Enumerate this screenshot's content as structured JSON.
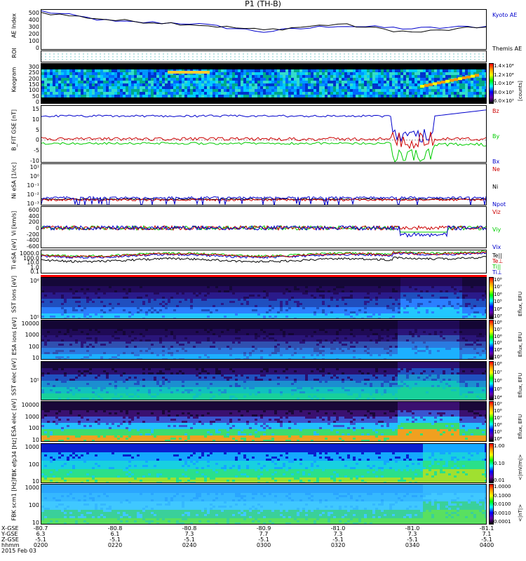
{
  "title": "P1 (TH-B)",
  "colors": {
    "black": "#000000",
    "blue": "#0000cc",
    "red": "#cc0000",
    "green": "#00cc00"
  },
  "panels": {
    "ae": {
      "ylabel": "AE Index",
      "yticks": [
        "500",
        "400",
        "300",
        "200",
        "100",
        "0"
      ],
      "legend": [
        "Kyoto AE",
        "Themis AE"
      ]
    },
    "roi": {
      "ylabel": "ROI"
    },
    "keo": {
      "ylabel": "Keogram",
      "yticks": [
        "300",
        "250",
        "200",
        "150",
        "100",
        "50",
        "0"
      ],
      "unit": "[counts]",
      "cticks": [
        "1.4×10⁴",
        "1.2×10⁴",
        "1.0×10⁴",
        "8.0×10³",
        "6.0×10³"
      ]
    },
    "bfit": {
      "ylabel": "B_FIT GSE [nT]",
      "yticks": [
        "15",
        "10",
        "5",
        "0",
        "-5",
        "-10"
      ],
      "legend": [
        "Bz",
        "By",
        "Bx"
      ]
    },
    "ni": {
      "ylabel": "Ni eSA [1/cc]",
      "yticks": [
        "10¹",
        "10⁰",
        "10⁻¹",
        "10⁻²",
        "10⁻³"
      ],
      "legend": [
        "Ne",
        "Ni",
        "Npot"
      ]
    },
    "vi": {
      "ylabel": "Vi [km/s]",
      "yticks": [
        "600",
        "400",
        "200",
        "0",
        "-200",
        "-400",
        "-600"
      ],
      "legend": [
        "Viz",
        "Viy",
        "Vix"
      ]
    },
    "ti": {
      "ylabel": "Ti eSA [eV]",
      "yticks": [
        "1000.0",
        "100.0",
        "10.0",
        "1.0",
        "0.1"
      ],
      "legend": [
        "Te||",
        "Te⊥",
        "Ti||",
        "Ti⊥"
      ]
    },
    "sst_i": {
      "ylabel": "SST ions [eV]",
      "yticks": [
        "10⁶",
        "10⁵"
      ],
      "cunit": "Eflux, EFU",
      "cticks": [
        "10⁸",
        "10⁷",
        "10⁶",
        "10⁵",
        "10⁴",
        "10³"
      ]
    },
    "esa_i": {
      "ylabel": "ESA ions [eV]",
      "yticks": [
        "10000",
        "1000",
        "100",
        "10"
      ],
      "cunit": "Eflux, EFU",
      "cticks": [
        "10⁸",
        "10⁷",
        "10⁶",
        "10⁵",
        "10⁴",
        "10³"
      ]
    },
    "sst_e": {
      "ylabel": "SST elec [eV]",
      "yticks": [
        "10⁵"
      ],
      "cunit": "Eflux, EFU",
      "cticks": [
        "10⁸",
        "10⁷",
        "10⁶",
        "10⁵",
        "10⁴"
      ]
    },
    "esa_e": {
      "ylabel": "ESA elec [eV]",
      "yticks": [
        "10000",
        "1000",
        "100",
        "10"
      ],
      "cunit": "Eflux, EFU",
      "cticks": [
        "10⁹",
        "10⁸",
        "10⁷",
        "10⁶",
        "10⁵",
        "10⁴"
      ]
    },
    "fbk1": {
      "ylabel": "FBK efp34 [Hz]",
      "yticks": [
        "1000",
        "100",
        "10"
      ],
      "cunit": "<|mV/m|>",
      "cticks": [
        "1.00",
        "0.10",
        "0.01"
      ]
    },
    "fbk2": {
      "ylabel": "FBK scm1 [Hz]",
      "yticks": [
        "1000",
        "100",
        "10"
      ],
      "cunit": "<|nT|>",
      "cticks": [
        "1.0000",
        "0.1000",
        "0.0100",
        "0.0010",
        "0.0001"
      ]
    }
  },
  "xaxis": {
    "row_labels": [
      "X-GSE",
      "Y-GSE",
      "Z-GSE",
      "hhmm",
      "2015 Feb 03"
    ],
    "ticks": [
      {
        "x": "-80.7",
        "y": "6.3",
        "z": "-5.1",
        "t": "0200"
      },
      {
        "x": "-80.8",
        "y": "6.1",
        "z": "-5.1",
        "t": "0220"
      },
      {
        "x": "-80.8",
        "y": "7.3",
        "z": "-5.1",
        "t": "0240"
      },
      {
        "x": "-80.9",
        "y": "7.7",
        "z": "-5.1",
        "t": "0300"
      },
      {
        "x": "-81.0",
        "y": "7.3",
        "z": "-5.1",
        "t": "0320"
      },
      {
        "x": "-81.0",
        "y": "7.3",
        "z": "-5.1",
        "t": "0340"
      },
      {
        "x": "-81.1",
        "y": "7.1",
        "z": "-5.1",
        "t": "0400"
      }
    ]
  },
  "chart_data": {
    "type": "line",
    "title": "P1 (TH-B)",
    "x_range_hhmm": [
      "0200",
      "0400"
    ],
    "series": [
      {
        "name": "Kyoto AE",
        "times": [
          "0200",
          "0220",
          "0240",
          "0300",
          "0320",
          "0340",
          "0400"
        ],
        "values": [
          500,
          360,
          340,
          230,
          310,
          270,
          300
        ]
      },
      {
        "name": "Themis AE",
        "times": [
          "0200",
          "0220",
          "0240",
          "0300",
          "0320",
          "0340",
          "0400"
        ],
        "values": [
          480,
          380,
          330,
          250,
          330,
          220,
          290
        ]
      }
    ]
  }
}
